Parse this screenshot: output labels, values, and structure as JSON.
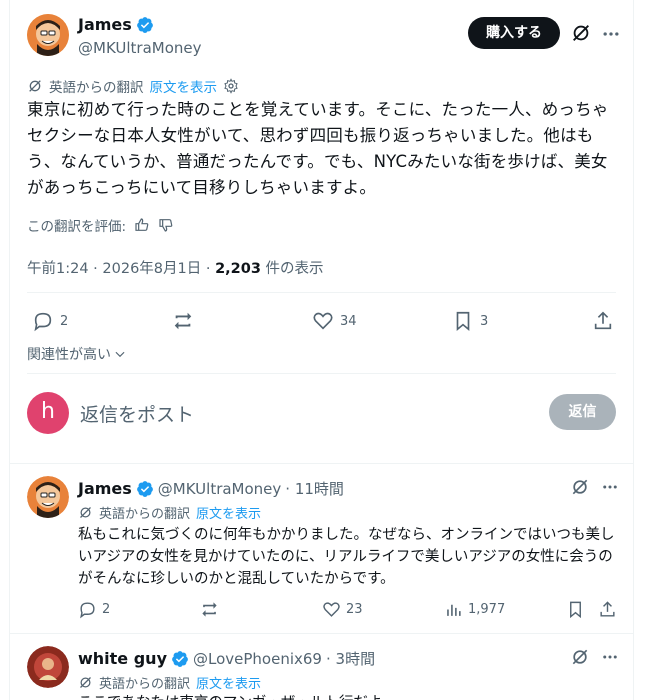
{
  "main_tweet": {
    "name": "James",
    "handle": "@MKUltraMoney",
    "buy_label": "購入する",
    "translation_label": "英語からの翻訳",
    "show_original": "原文を表示",
    "body": "東京に初めて行った時のことを覚えています。そこに、たった一人、めっちゃセクシーな日本人女性がいて、思わず四回も振り返っちゃいました。他はもう、なんていうか、普通だったんです。でも、NYCみたいな街を歩けば、美女があっちこっちにいて目移りしちゃいますよ。",
    "rate_translation": "この翻訳を評価:",
    "timestamp": "午前1:24 · 2026年8月1日 · ",
    "views_count": "2,203",
    "views_label": " 件の表示",
    "replies": "2",
    "likes": "34",
    "bookmarks": "3"
  },
  "sort": {
    "label": "関連性が高い"
  },
  "composer": {
    "avatar_letter": "h",
    "placeholder": "返信をポスト",
    "reply_button": "返信"
  },
  "replies": [
    {
      "name": "James",
      "handle": "@MKUltraMoney",
      "time": "· 11時間",
      "translation_label": "英語からの翻訳",
      "show_original": "原文を表示",
      "body": "私もこれに気づくのに何年もかかりました。なぜなら、オンラインではいつも美しいアジアの女性を見かけていたのに、リアルライフで美しいアジアの女性に会うのがそんなに珍しいのかと混乱していたからです。",
      "replies": "2",
      "likes": "23",
      "views": "1,977"
    },
    {
      "name": "white guy",
      "handle": "@LovePhoenix69",
      "time": "· 3時間",
      "translation_label": "英語からの翻訳",
      "show_original": "原文を表示",
      "body": "ここであなたは東京のマンガ・ザ・ルト行だよ"
    }
  ],
  "colors": {
    "accent": "#1d9bf0",
    "text": "#0f1419",
    "muted": "#536471",
    "border": "#eff3f4",
    "composer_avatar": "#e0426e"
  },
  "icons": {
    "verified": "verified-badge-icon",
    "grok": "grok-icon",
    "more": "more-dots-icon",
    "translate": "translate-icon",
    "gear": "gear-icon",
    "thumbs_up": "thumbs-up-icon",
    "thumbs_down": "thumbs-down-icon",
    "reply": "reply-icon",
    "repost": "repost-icon",
    "like": "heart-icon",
    "bookmark": "bookmark-icon",
    "share": "share-icon",
    "views": "views-icon",
    "chevron": "chevron-down-icon"
  }
}
